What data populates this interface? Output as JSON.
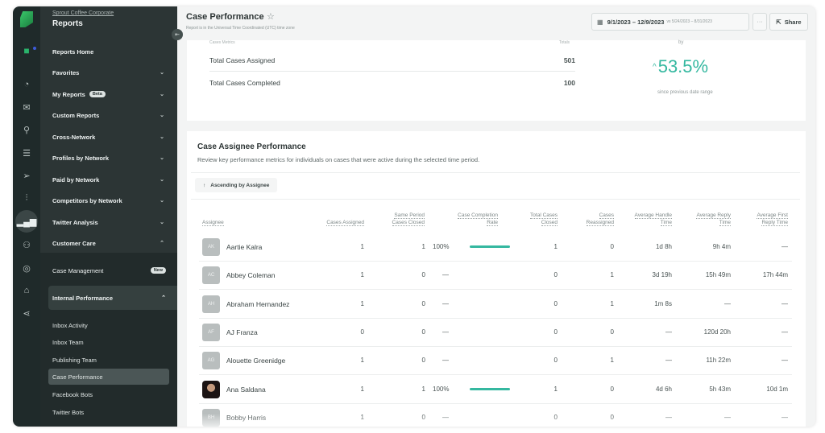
{
  "sidebar": {
    "org_name": "Sprout Coffee Corporate",
    "title": "Reports",
    "rail_icons": [
      "logo-icon",
      "folder-icon",
      "dashboard-icon",
      "inbox-icon",
      "pin-icon",
      "list-icon",
      "send-icon",
      "listening-icon",
      "reports-icon",
      "people-icon",
      "support-icon",
      "store-icon",
      "share-icon"
    ],
    "items": [
      {
        "label": "Reports Home"
      },
      {
        "label": "Favorites",
        "chevron": "⌄"
      },
      {
        "label": "My Reports",
        "badge": "Beta",
        "chevron": "⌄"
      },
      {
        "label": "Custom Reports",
        "chevron": "⌄"
      },
      {
        "label": "Cross-Network",
        "chevron": "⌄"
      },
      {
        "label": "Profiles by Network",
        "chevron": "⌄"
      },
      {
        "label": "Paid by Network",
        "chevron": "⌄"
      },
      {
        "label": "Competitors by Network",
        "chevron": "⌄"
      },
      {
        "label": "Twitter Analysis",
        "chevron": "⌄"
      },
      {
        "label": "Customer Care",
        "chevron": "⌃"
      }
    ],
    "customer_care": {
      "case_management": "Case Management",
      "badge": "New"
    },
    "internal_performance": {
      "label": "Internal Performance",
      "chevron": "⌃",
      "items": [
        "Inbox Activity",
        "Inbox Team",
        "Publishing Team",
        "Case Performance",
        "Facebook Bots",
        "Twitter Bots"
      ],
      "active": "Case Performance"
    }
  },
  "header": {
    "title": "Case Performance",
    "subtitle": "Report is in the Universal Time Coordinated (UTC) time zone",
    "date_range": "9/1/2023 – 12/9/2023",
    "compare_range": "vs 5/24/2023 – 8/31/2023",
    "more_label": "···",
    "share_label": "Share"
  },
  "summary": {
    "cut_label": "Cases Metrics",
    "cut_total": "Totals",
    "rows": [
      {
        "label": "Total Cases Assigned",
        "value": "501"
      },
      {
        "label": "Total Cases Completed",
        "value": "100"
      }
    ],
    "by_label": "by",
    "change": "53.5%",
    "change_arrow": "^",
    "change_caption": "since previous date range",
    "accent": "#35b8a0"
  },
  "table": {
    "title": "Case Assignee Performance",
    "description": "Review key performance metrics for individuals on cases that were active during the selected time period.",
    "sort_label": "Ascending by Assignee",
    "columns": [
      {
        "l1": "",
        "l2": "Assignee"
      },
      {
        "l1": "",
        "l2": "Cases Assigned"
      },
      {
        "l1": "Same Period",
        "l2": "Cases Closed"
      },
      {
        "l1": "Case Completion",
        "l2": "Rate"
      },
      {
        "l1": "Total Cases",
        "l2": "Closed"
      },
      {
        "l1": "Cases",
        "l2": "Reassigned"
      },
      {
        "l1": "Average Handle",
        "l2": "Time"
      },
      {
        "l1": "Average Reply",
        "l2": "Time"
      },
      {
        "l1": "Average First",
        "l2": "Reply Time"
      }
    ],
    "rows": [
      {
        "initials": "AK",
        "name": "Aartie Kalra",
        "assigned": "1",
        "closed_same": "1",
        "rate": "100%",
        "rate_value": 1.0,
        "total_closed": "1",
        "reassigned": "0",
        "handle": "1d 8h",
        "reply": "9h 4m",
        "first_reply": "—"
      },
      {
        "initials": "AC",
        "name": "Abbey Coleman",
        "assigned": "1",
        "closed_same": "0",
        "rate": "—",
        "rate_value": null,
        "total_closed": "0",
        "reassigned": "1",
        "handle": "3d 19h",
        "reply": "15h 49m",
        "first_reply": "17h 44m"
      },
      {
        "initials": "AH",
        "name": "Abraham Hernandez",
        "assigned": "1",
        "closed_same": "0",
        "rate": "—",
        "rate_value": null,
        "total_closed": "0",
        "reassigned": "1",
        "handle": "1m 8s",
        "reply": "—",
        "first_reply": "—"
      },
      {
        "initials": "AF",
        "name": "AJ Franza",
        "assigned": "0",
        "closed_same": "0",
        "rate": "—",
        "rate_value": null,
        "total_closed": "0",
        "reassigned": "0",
        "handle": "—",
        "reply": "120d 20h",
        "first_reply": "—"
      },
      {
        "initials": "AG",
        "name": "Alouette Greenidge",
        "assigned": "1",
        "closed_same": "0",
        "rate": "—",
        "rate_value": null,
        "total_closed": "0",
        "reassigned": "1",
        "handle": "—",
        "reply": "11h 22m",
        "first_reply": "—"
      },
      {
        "initials": "",
        "name": "Ana Saldana",
        "photo": true,
        "assigned": "1",
        "closed_same": "1",
        "rate": "100%",
        "rate_value": 1.0,
        "total_closed": "1",
        "reassigned": "0",
        "handle": "4d 6h",
        "reply": "5h 43m",
        "first_reply": "10d 1m"
      },
      {
        "initials": "BH",
        "name": "Bobby Harris",
        "assigned": "1",
        "closed_same": "0",
        "rate": "—",
        "rate_value": null,
        "total_closed": "0",
        "reassigned": "0",
        "handle": "—",
        "reply": "—",
        "first_reply": "—"
      }
    ]
  }
}
